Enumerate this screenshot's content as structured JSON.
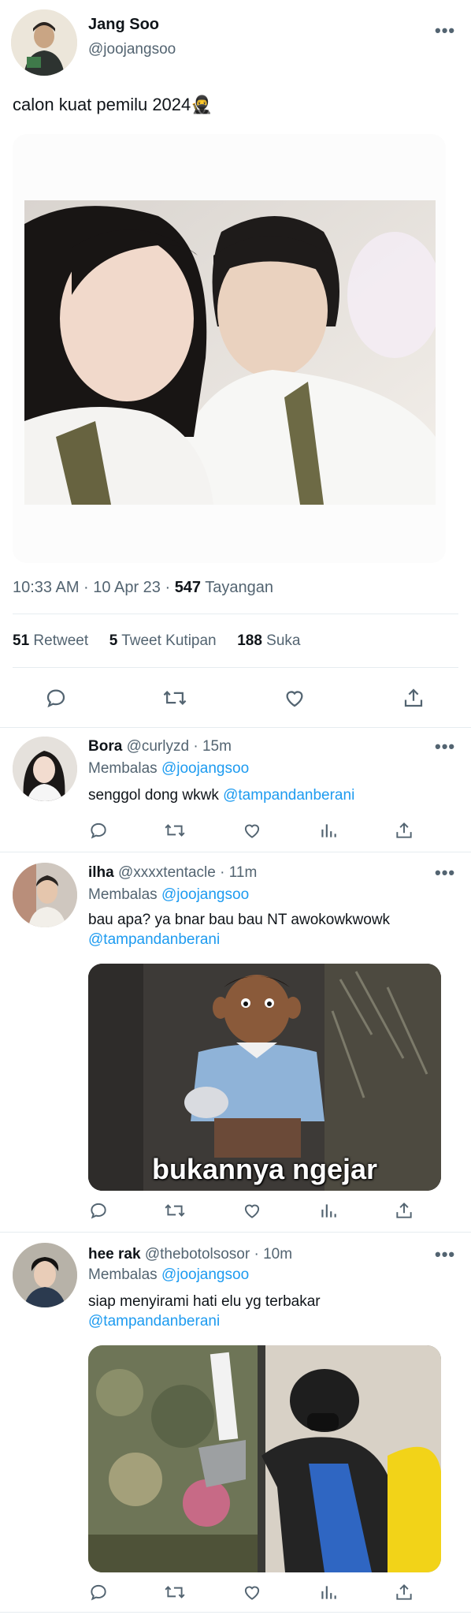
{
  "main_tweet": {
    "author_name": "Jang Soo",
    "author_handle": "@joojangsoo",
    "text": "calon kuat pemilu 2024🥷",
    "time": "10:33 AM · 10 Apr 23 · ",
    "views_count": "547",
    "views_label": "Tayangan",
    "retweets_count": "51",
    "retweets_label": "Retweet",
    "quotes_count": "5",
    "quotes_label": "Tweet Kutipan",
    "likes_count": "188",
    "likes_label": "Suka"
  },
  "replies": [
    {
      "name": "Bora",
      "handle": "@curlyzd",
      "time": "· 15m",
      "replying_prefix": "Membalas",
      "replying_to": "@joojangsoo",
      "text": "senggol dong wkwk",
      "mention": "@tampandanberani"
    },
    {
      "name": "ilha",
      "handle": "@xxxxtentacle",
      "time": "· 11m",
      "replying_prefix": "Membalas",
      "replying_to": "@joojangsoo",
      "text": "bau apa? ya bnar bau bau NT awokowkwowk",
      "mention": "@tampandanberani",
      "media_caption": "bukannya ngejar"
    },
    {
      "name": "hee rak",
      "handle": "@thebotolsosor",
      "time": "· 10m",
      "replying_prefix": "Membalas",
      "replying_to": "@joojangsoo",
      "text": "siap menyirami hati elu yg terbakar",
      "mention": "@tampandanberani"
    }
  ],
  "colors": {
    "link": "#1d9bf0",
    "secondary_text": "#536471",
    "divider": "#e6ecf0"
  }
}
